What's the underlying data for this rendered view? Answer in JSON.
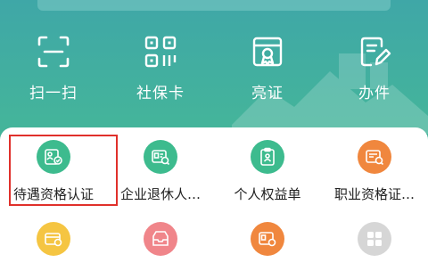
{
  "quick_actions": [
    {
      "label": "扫一扫",
      "icon": "scan-icon"
    },
    {
      "label": "社保卡",
      "icon": "qr-code-icon"
    },
    {
      "label": "亮证",
      "icon": "certificate-icon"
    },
    {
      "label": "办件",
      "icon": "document-edit-icon"
    }
  ],
  "services_row1": [
    {
      "label": "待遇资格认证",
      "icon": "person-card-check-icon",
      "color": "#3dbb8e"
    },
    {
      "label": "企业退休人…",
      "icon": "id-card-search-icon",
      "color": "#3dbb8e"
    },
    {
      "label": "个人权益单",
      "icon": "clipboard-person-icon",
      "color": "#3dbb8e"
    },
    {
      "label": "职业资格证…",
      "icon": "certificate-search-icon",
      "color": "#f0873e"
    }
  ],
  "services_row2": [
    {
      "icon": "card-check-icon",
      "color": "#f5c542"
    },
    {
      "icon": "inbox-person-icon",
      "color": "#f0858a"
    },
    {
      "icon": "id-card-search-icon",
      "color": "#f0873e"
    },
    {
      "icon": "more-grid-icon",
      "color": "#d6d6d6"
    }
  ],
  "highlight_color": "#e0302b"
}
